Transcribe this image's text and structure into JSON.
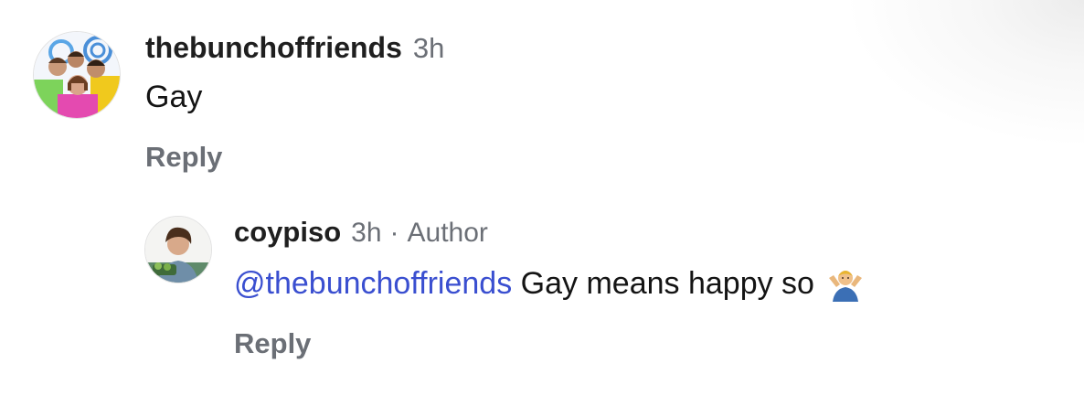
{
  "comments": [
    {
      "username": "thebunchoffriends",
      "time": "3h",
      "text": "Gay",
      "reply_label": "Reply",
      "avatar_icon": "group-photo-avatar"
    }
  ],
  "reply": {
    "username": "coypiso",
    "time": "3h",
    "separator": "·",
    "author_tag": "Author",
    "mention": "@thebunchoffriends",
    "text": "Gay means happy so",
    "emoji": "person-shrugging-emoji",
    "reply_label": "Reply",
    "avatar_icon": "person-photo-avatar"
  },
  "colors": {
    "mention": "#3a4fd0",
    "muted": "#6b6f76",
    "text": "#141414"
  }
}
